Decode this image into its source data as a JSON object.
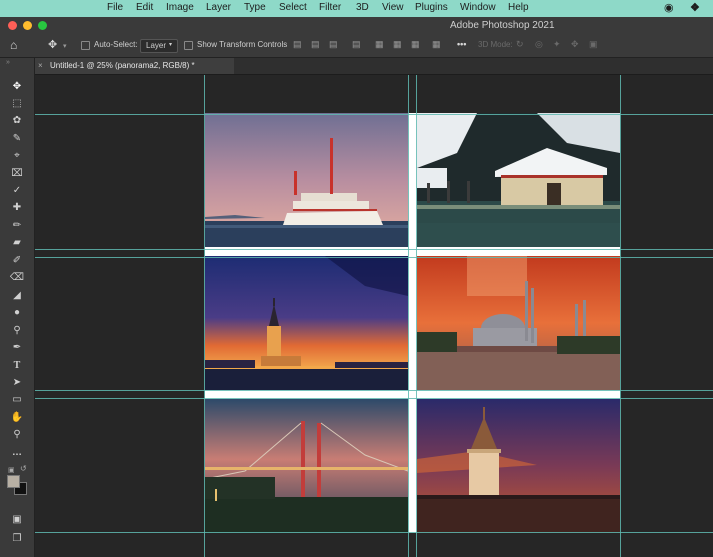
{
  "menubar": {
    "items": [
      "File",
      "Edit",
      "Image",
      "Layer",
      "Type",
      "Select",
      "Filter",
      "3D",
      "View",
      "Plugins",
      "Window",
      "Help"
    ]
  },
  "window": {
    "title": "Adobe Photoshop 2021"
  },
  "options": {
    "auto_select_label": "Auto-Select:",
    "layer_select_value": "Layer",
    "show_transform_label": "Show Transform Controls",
    "mode_3d_label": "3D Mode:"
  },
  "document": {
    "tab_title": "Untitled-1 @ 25% (panorama2, RGB/8) *"
  },
  "photos": [
    {
      "subject": "ferry at dusk"
    },
    {
      "subject": "snowy house by water"
    },
    {
      "subject": "maiden's tower at sunset"
    },
    {
      "subject": "mosque under red sky"
    },
    {
      "subject": "suspension bridge at dusk"
    },
    {
      "subject": "galata tower at night"
    }
  ],
  "colors": {
    "menubar_bg": "#8ed9c8",
    "chrome_bg": "#3a3a3a",
    "canvas_bg": "#262626",
    "guide": "#5fb8b0",
    "close": "#fe5f57",
    "minimize": "#febc2e",
    "maximize": "#28c840"
  }
}
